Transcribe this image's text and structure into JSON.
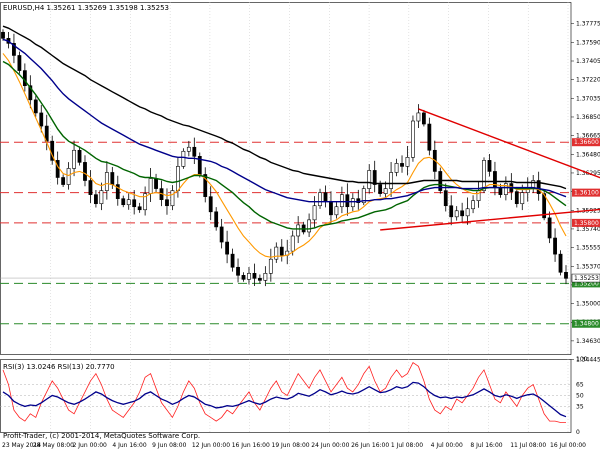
{
  "chart_header": {
    "symbol_info": "EURUSD,H4  1.35261 1.35269 1.35198 1.35253",
    "indicator_info": "RSI(3) 13.0246  RSI(13) 20.7770",
    "copyright": "Profit-Trader, (c) 2001-2014, MetaQuotes Software Corp."
  },
  "colors": {
    "background": "#ffffff",
    "candles": "#000000",
    "ema_fast": "#ff9900",
    "ema_mid": "#006400",
    "ema_slow": "#00008b",
    "ema_long": "#000000",
    "resistance": "#e03030",
    "support": "#2a8a2a",
    "trendline": "#e00000",
    "rsi_fast": "#ff2020",
    "rsi_slow": "#00008b"
  },
  "chart_data": [
    {
      "type": "line",
      "panel": "price",
      "ylim": [
        1.345,
        1.3799
      ],
      "y_ticks": [
        1.37775,
        1.3759,
        1.37405,
        1.3722,
        1.37035,
        1.3685,
        1.36665,
        1.3648,
        1.36295,
        1.3611,
        1.35925,
        1.3574,
        1.35555,
        1.3537,
        1.35185,
        1.35,
        1.34815,
        1.3463,
        1.34445
      ],
      "y_tick_labels": [
        "1.37775",
        "1.37590",
        "1.37405",
        "1.37220",
        "1.37035",
        "1.36850",
        "1.36665",
        "1.36480",
        "1.36295",
        "1.36110",
        "1.35925",
        "1.35740",
        "1.35555",
        "1.35370",
        "1.35185",
        "1.35000",
        "1.34815",
        "1.34630",
        "1.34445"
      ],
      "x_tick_labels": [
        "23 May 2014",
        "28 May 08:00",
        "2 Jun 00:00",
        "4 Jun 16:00",
        "9 Jun 08:00",
        "12 Jun 00:00",
        "16 Jun 16:00",
        "19 Jun 08:00",
        "24 Jun 00:00",
        "26 Jun 16:00",
        "1 Jul 08:00",
        "4 Jul 00:00",
        "8 Jul 16:00",
        "11 Jul 08:00",
        "16 Jul 00:00"
      ],
      "candles_close": [
        1.3763,
        1.3758,
        1.3746,
        1.3731,
        1.3716,
        1.3702,
        1.3689,
        1.3676,
        1.3661,
        1.3642,
        1.3625,
        1.3618,
        1.3634,
        1.3652,
        1.364,
        1.3622,
        1.3608,
        1.3599,
        1.3612,
        1.363,
        1.3618,
        1.3604,
        1.3598,
        1.3603,
        1.3596,
        1.3593,
        1.3609,
        1.3624,
        1.3614,
        1.3603,
        1.3597,
        1.3612,
        1.3636,
        1.3651,
        1.3655,
        1.3646,
        1.3628,
        1.3606,
        1.3591,
        1.3576,
        1.3561,
        1.3549,
        1.3536,
        1.3528,
        1.3524,
        1.353,
        1.3525,
        1.3523,
        1.353,
        1.3544,
        1.3556,
        1.3548,
        1.3552,
        1.3567,
        1.3578,
        1.3571,
        1.3583,
        1.3597,
        1.361,
        1.3601,
        1.3588,
        1.3596,
        1.3608,
        1.3596,
        1.3604,
        1.36,
        1.3614,
        1.3632,
        1.3618,
        1.3609,
        1.3614,
        1.363,
        1.3639,
        1.3636,
        1.3645,
        1.3681,
        1.3689,
        1.3678,
        1.3652,
        1.3631,
        1.3612,
        1.3597,
        1.3586,
        1.3592,
        1.3587,
        1.3594,
        1.3602,
        1.3612,
        1.3642,
        1.3631,
        1.3615,
        1.3608,
        1.3619,
        1.3611,
        1.3599,
        1.361,
        1.3614,
        1.3622,
        1.3609,
        1.3585,
        1.3565,
        1.3549,
        1.3531,
        1.3525
      ],
      "series": [
        {
          "name": "",
          "values": [
            1.3748,
            1.3741,
            1.3731,
            1.372,
            1.3708,
            1.3696,
            1.3684,
            1.3672,
            1.366,
            1.3647,
            1.3636,
            1.3629,
            1.3627,
            1.363,
            1.3631,
            1.3629,
            1.3625,
            1.3619,
            1.3617,
            1.3619,
            1.3618,
            1.3615,
            1.3612,
            1.361,
            1.3608,
            1.3606,
            1.3606,
            1.3609,
            1.361,
            1.3609,
            1.3607,
            1.3608,
            1.3612,
            1.3619,
            1.3625,
            1.3628,
            1.3628,
            1.3624,
            1.3618,
            1.3611,
            1.3602,
            1.3593,
            1.3584,
            1.3575,
            1.3567,
            1.3561,
            1.3555,
            1.355,
            1.3547,
            1.3546,
            1.3547,
            1.3547,
            1.3548,
            1.3551,
            1.3555,
            1.3558,
            1.3562,
            1.3568,
            1.3575,
            1.3579,
            1.3581,
            1.3583,
            1.3587,
            1.3589,
            1.3591,
            1.3592,
            1.3596,
            1.3601,
            1.3603,
            1.3604,
            1.3605,
            1.3609,
            1.3613,
            1.3616,
            1.362,
            1.363,
            1.3639,
            1.3644,
            1.3645,
            1.3642,
            1.3637,
            1.363,
            1.3623,
            1.3618,
            1.3614,
            1.3611,
            1.3609,
            1.3609,
            1.3615,
            1.3618,
            1.3618,
            1.3617,
            1.3617,
            1.3616,
            1.3613,
            1.3613,
            1.3613,
            1.3614,
            1.3613,
            1.3608,
            1.3599,
            1.3589,
            1.3577,
            1.3567
          ]
        },
        {
          "name": "",
          "values": [
            1.374,
            1.3737,
            1.3732,
            1.3727,
            1.3721,
            1.3714,
            1.3707,
            1.3699,
            1.3691,
            1.3682,
            1.3673,
            1.3666,
            1.3661,
            1.3658,
            1.3655,
            1.3652,
            1.3648,
            1.3644,
            1.3641,
            1.364,
            1.3638,
            1.3636,
            1.3633,
            1.3631,
            1.3629,
            1.3626,
            1.3625,
            1.3625,
            1.3624,
            1.3623,
            1.3621,
            1.362,
            1.3621,
            1.3623,
            1.3625,
            1.3627,
            1.3627,
            1.3626,
            1.3624,
            1.3622,
            1.3618,
            1.3614,
            1.361,
            1.3605,
            1.36,
            1.3596,
            1.3591,
            1.3587,
            1.3584,
            1.3581,
            1.3579,
            1.3577,
            1.3575,
            1.3574,
            1.3574,
            1.3574,
            1.3574,
            1.3575,
            1.3577,
            1.3578,
            1.3579,
            1.358,
            1.3582,
            1.3583,
            1.3584,
            1.3585,
            1.3587,
            1.3589,
            1.3591,
            1.3592,
            1.3593,
            1.3595,
            1.3598,
            1.36,
            1.3602,
            1.3607,
            1.3611,
            1.3615,
            1.3617,
            1.3618,
            1.3618,
            1.3617,
            1.3616,
            1.3615,
            1.3614,
            1.3613,
            1.3612,
            1.3612,
            1.3614,
            1.3615,
            1.3615,
            1.3615,
            1.3615,
            1.3615,
            1.3614,
            1.3614,
            1.3614,
            1.3614,
            1.3614,
            1.3612,
            1.3609,
            1.3605,
            1.3601,
            1.3597
          ]
        },
        {
          "name": "",
          "values": [
            1.3762,
            1.376,
            1.3756,
            1.3752,
            1.3748,
            1.3743,
            1.3738,
            1.3733,
            1.3727,
            1.3721,
            1.3714,
            1.3708,
            1.3703,
            1.3699,
            1.3695,
            1.3691,
            1.3687,
            1.3683,
            1.3679,
            1.3676,
            1.3673,
            1.367,
            1.3667,
            1.3664,
            1.3661,
            1.3658,
            1.3656,
            1.3654,
            1.3652,
            1.365,
            1.3648,
            1.3646,
            1.3645,
            1.3645,
            1.3644,
            1.3644,
            1.3643,
            1.3642,
            1.3641,
            1.3639,
            1.3636,
            1.3634,
            1.3631,
            1.3628,
            1.3625,
            1.3622,
            1.3619,
            1.3616,
            1.3613,
            1.3611,
            1.3609,
            1.3607,
            1.3605,
            1.3604,
            1.3603,
            1.3602,
            1.3601,
            1.3601,
            1.3601,
            1.3601,
            1.3601,
            1.3601,
            1.3601,
            1.3601,
            1.3601,
            1.3601,
            1.3602,
            1.3602,
            1.3603,
            1.3603,
            1.3604,
            1.3604,
            1.3605,
            1.3606,
            1.3607,
            1.3609,
            1.3611,
            1.3613,
            1.3614,
            1.3615,
            1.3615,
            1.3615,
            1.3615,
            1.3615,
            1.3614,
            1.3614,
            1.3614,
            1.3614,
            1.3615,
            1.3615,
            1.3615,
            1.3615,
            1.3615,
            1.3615,
            1.3615,
            1.3615,
            1.3615,
            1.3615,
            1.3614,
            1.3613,
            1.3612,
            1.361,
            1.3608,
            1.3606
          ]
        },
        {
          "name": "",
          "values": [
            1.3775,
            1.3773,
            1.377,
            1.3767,
            1.3764,
            1.3761,
            1.3757,
            1.3754,
            1.375,
            1.3746,
            1.3742,
            1.3738,
            1.3735,
            1.3732,
            1.3729,
            1.3726,
            1.3722,
            1.3719,
            1.3716,
            1.3713,
            1.371,
            1.3707,
            1.3704,
            1.3701,
            1.3698,
            1.3695,
            1.3693,
            1.369,
            1.3688,
            1.3686,
            1.3683,
            1.3681,
            1.3679,
            1.3677,
            1.3676,
            1.3674,
            1.3672,
            1.367,
            1.3668,
            1.3666,
            1.3664,
            1.3661,
            1.3659,
            1.3656,
            1.3653,
            1.3651,
            1.3648,
            1.3645,
            1.3643,
            1.364,
            1.3638,
            1.3636,
            1.3634,
            1.3632,
            1.3631,
            1.3629,
            1.3628,
            1.3627,
            1.3626,
            1.3625,
            1.3624,
            1.3623,
            1.3622,
            1.3621,
            1.3621,
            1.362,
            1.362,
            1.362,
            1.3619,
            1.3619,
            1.3619,
            1.3619,
            1.3619,
            1.3619,
            1.3619,
            1.362,
            1.3621,
            1.3622,
            1.3622,
            1.3622,
            1.3622,
            1.3622,
            1.3622,
            1.3622,
            1.3621,
            1.3621,
            1.3621,
            1.3621,
            1.3621,
            1.3621,
            1.3621,
            1.3621,
            1.3621,
            1.3621,
            1.362,
            1.362,
            1.362,
            1.362,
            1.362,
            1.3619,
            1.3618,
            1.3617,
            1.3616,
            1.3614
          ]
        }
      ],
      "horizontal_levels": [
        {
          "value": 1.366,
          "label": "1.36600",
          "kind": "resistance"
        },
        {
          "value": 1.361,
          "label": "1.36100",
          "kind": "resistance"
        },
        {
          "value": 1.358,
          "label": "1.35800",
          "kind": "resistance"
        },
        {
          "value": 1.352,
          "label": "1.35200",
          "kind": "support"
        },
        {
          "value": 1.348,
          "label": "1.34800",
          "kind": "support"
        }
      ],
      "current_price": {
        "value": 1.35253,
        "label": "1.35253"
      },
      "trendlines": [
        {
          "from": [
            76,
            1.3693
          ],
          "to": [
            115,
            1.361
          ]
        },
        {
          "from": [
            69,
            1.3573
          ],
          "to": [
            115,
            1.3597
          ]
        }
      ]
    },
    {
      "type": "line",
      "panel": "indicator",
      "ylim": [
        0,
        100
      ],
      "y_tick_labels": [
        "100",
        "65",
        "50",
        "35",
        "0"
      ],
      "y_ticks": [
        100,
        65,
        50,
        35,
        0
      ],
      "levels": [
        65,
        50,
        35
      ],
      "series": [
        {
          "name": "",
          "values": [
            85,
            65,
            30,
            20,
            15,
            25,
            20,
            40,
            55,
            70,
            60,
            45,
            30,
            25,
            40,
            55,
            70,
            80,
            65,
            45,
            30,
            25,
            20,
            30,
            40,
            55,
            75,
            80,
            60,
            40,
            30,
            20,
            35,
            55,
            70,
            60,
            40,
            25,
            20,
            15,
            20,
            30,
            25,
            35,
            45,
            55,
            40,
            30,
            45,
            60,
            70,
            55,
            50,
            65,
            80,
            70,
            60,
            75,
            85,
            70,
            55,
            65,
            75,
            60,
            55,
            65,
            80,
            90,
            70,
            55,
            60,
            75,
            85,
            75,
            80,
            95,
            90,
            70,
            45,
            30,
            25,
            35,
            30,
            45,
            40,
            50,
            60,
            75,
            85,
            65,
            45,
            40,
            55,
            45,
            35,
            50,
            60,
            65,
            45,
            25,
            15,
            15,
            13,
            13
          ]
        },
        {
          "name": "",
          "values": [
            55,
            50,
            42,
            38,
            35,
            37,
            36,
            40,
            45,
            50,
            48,
            44,
            40,
            38,
            41,
            45,
            50,
            55,
            52,
            47,
            43,
            40,
            38,
            40,
            42,
            46,
            52,
            55,
            50,
            45,
            42,
            38,
            41,
            46,
            50,
            48,
            43,
            38,
            36,
            33,
            34,
            36,
            35,
            37,
            40,
            43,
            40,
            38,
            41,
            45,
            48,
            46,
            45,
            48,
            53,
            51,
            49,
            53,
            58,
            55,
            51,
            53,
            56,
            53,
            52,
            54,
            58,
            62,
            58,
            54,
            55,
            58,
            62,
            60,
            62,
            68,
            67,
            62,
            55,
            50,
            47,
            48,
            46,
            48,
            47,
            49,
            51,
            55,
            59,
            55,
            50,
            48,
            51,
            49,
            46,
            49,
            51,
            52,
            48,
            42,
            36,
            30,
            24,
            21
          ]
        }
      ]
    }
  ]
}
